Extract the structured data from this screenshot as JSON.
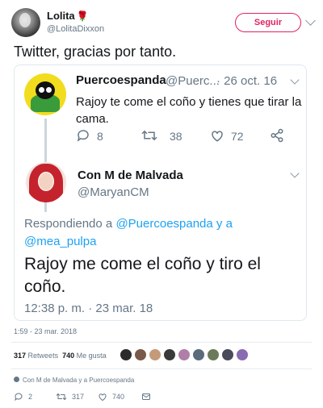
{
  "tweet": {
    "author_name": "Lolita",
    "author_emoji": "🌹",
    "author_handle": "@LolitaDixxon",
    "follow_label": "Seguir",
    "text": "Twitter, gracias por tanto.",
    "timestamp": "1:59 - 23 mar. 2018",
    "retweets_count": "317",
    "retweets_label": "Retweets",
    "likes_count": "740",
    "likes_label": "Me gusta",
    "reply_note": "Con M de Malvada y a Puercoespanda",
    "actions": {
      "replies": "2",
      "retweets": "317",
      "likes": "740"
    }
  },
  "quoted": {
    "first": {
      "name": "Puercoespanda",
      "handle": "@Puerc...",
      "date": "· 26 oct. 16",
      "text": "Rajoy te come el coño y tienes que tirar la cama.",
      "replies": "8",
      "retweets": "38",
      "likes": "72"
    },
    "second": {
      "name": "Con M de Malvada",
      "handle": "@MaryanCM",
      "replying_prefix": "Respondiendo a",
      "replying_to_1": "@Puercoespanda y a",
      "replying_to_2": "@mea_pulpa",
      "text": "Rajoy me come el coño y tiro el coño.",
      "time": "12:38 p. m. · 23 mar. 18"
    }
  },
  "colors": {
    "accent_red": "#e0245e",
    "link_blue": "#1da1f2",
    "secondary_text": "#657786"
  },
  "icons": [
    "chevron-down-icon",
    "reply-icon",
    "retweet-icon",
    "like-icon",
    "share-icon",
    "message-icon",
    "person-icon"
  ]
}
